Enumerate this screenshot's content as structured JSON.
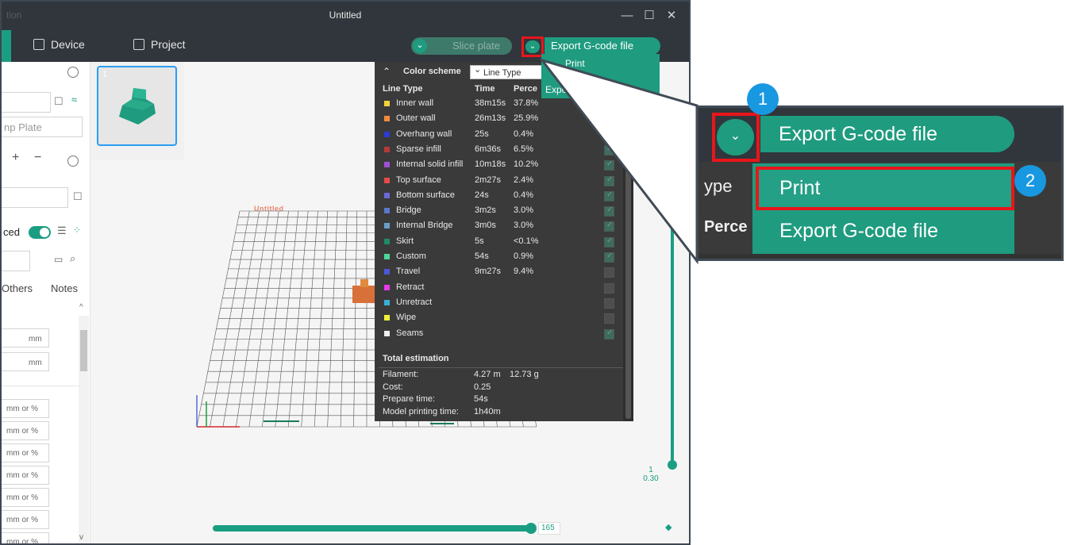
{
  "window": {
    "app_name": "tion",
    "title": "Untitled",
    "controls": {
      "minimize": "—",
      "maximize": "☐",
      "close": "✕"
    }
  },
  "topbar": {
    "device_label": "Device",
    "project_label": "Project",
    "slice_button": "Slice plate",
    "dropdown_glyph": "⌄",
    "export_button": "Export G-code file"
  },
  "sidebar": {
    "bed_plate_text": "np Plate",
    "advanced_label": "ced",
    "tabs": {
      "others": "Others",
      "notes": "Notes"
    },
    "unit_mm": "mm",
    "unit_mm_or_pct": "mm or %",
    "symbols": {
      "plus": "+",
      "minus": "−"
    }
  },
  "plates": {
    "plate_number": "1"
  },
  "viewport": {
    "plate_label": "Untitled"
  },
  "color_scheme": {
    "header": "Color scheme",
    "selector_value": "Line Type",
    "columns": {
      "line_type": "Line Type",
      "time": "Time",
      "percent": "Perce"
    },
    "rows": [
      {
        "name": "Inner wall",
        "time": "38m15s",
        "percent": "37.8%",
        "color": "#f2d23c",
        "checked": true
      },
      {
        "name": "Outer wall",
        "time": "26m13s",
        "percent": "25.9%",
        "color": "#f28c3c",
        "checked": true
      },
      {
        "name": "Overhang wall",
        "time": "25s",
        "percent": "0.4%",
        "color": "#2b3bd6",
        "checked": true
      },
      {
        "name": "Sparse infill",
        "time": "6m36s",
        "percent": "6.5%",
        "color": "#b33a3a",
        "checked": true
      },
      {
        "name": "Internal solid infill",
        "time": "10m18s",
        "percent": "10.2%",
        "color": "#a24fd6",
        "checked": true
      },
      {
        "name": "Top surface",
        "time": "2m27s",
        "percent": "2.4%",
        "color": "#e84a4a",
        "checked": true
      },
      {
        "name": "Bottom surface",
        "time": "24s",
        "percent": "0.4%",
        "color": "#6a6ad6",
        "checked": true
      },
      {
        "name": "Bridge",
        "time": "3m2s",
        "percent": "3.0%",
        "color": "#5a78c8",
        "checked": true
      },
      {
        "name": "Internal Bridge",
        "time": "3m0s",
        "percent": "3.0%",
        "color": "#6aa0c8",
        "checked": true
      },
      {
        "name": "Skirt",
        "time": "5s",
        "percent": "<0.1%",
        "color": "#1f8a6a",
        "checked": true
      },
      {
        "name": "Custom",
        "time": "54s",
        "percent": "0.9%",
        "color": "#4fd69a",
        "checked": true
      },
      {
        "name": "Travel",
        "time": "9m27s",
        "percent": "9.4%",
        "color": "#4a5ad6",
        "checked": false
      },
      {
        "name": "Retract",
        "time": "",
        "percent": "",
        "color": "#e83ae8",
        "checked": false
      },
      {
        "name": "Unretract",
        "time": "",
        "percent": "",
        "color": "#3ab0d6",
        "checked": false
      },
      {
        "name": "Wipe",
        "time": "",
        "percent": "",
        "color": "#f2f23a",
        "checked": false
      },
      {
        "name": "Seams",
        "time": "",
        "percent": "",
        "color": "#eeeeee",
        "checked": true
      }
    ],
    "total_header": "Total estimation",
    "estimation": [
      {
        "label": "Filament:",
        "value": "4.27 m",
        "value2": "12.73 g"
      },
      {
        "label": "Cost:",
        "value": "0.25",
        "value2": ""
      },
      {
        "label": "Prepare time:",
        "value": "54s",
        "value2": ""
      },
      {
        "label": "Model printing time:",
        "value": "1h40m",
        "value2": ""
      }
    ]
  },
  "menu_small": {
    "item1": "Print",
    "item2": "Expo"
  },
  "sliders": {
    "layer_top": "1",
    "layer_height": "0.30",
    "move_value": "165",
    "move_progress": 1.0
  },
  "zoom": {
    "export_button": "Export G-code file",
    "side_text_1": "ype",
    "side_text_2": "Perce",
    "menu_print": "Print",
    "menu_export": "Export G-code file",
    "badge_1": "1",
    "badge_2": "2"
  },
  "colors": {
    "accent": "#1f9b7f",
    "highlight": "#e8161b",
    "badge": "#1898e0",
    "dark_bar": "#30363b"
  }
}
